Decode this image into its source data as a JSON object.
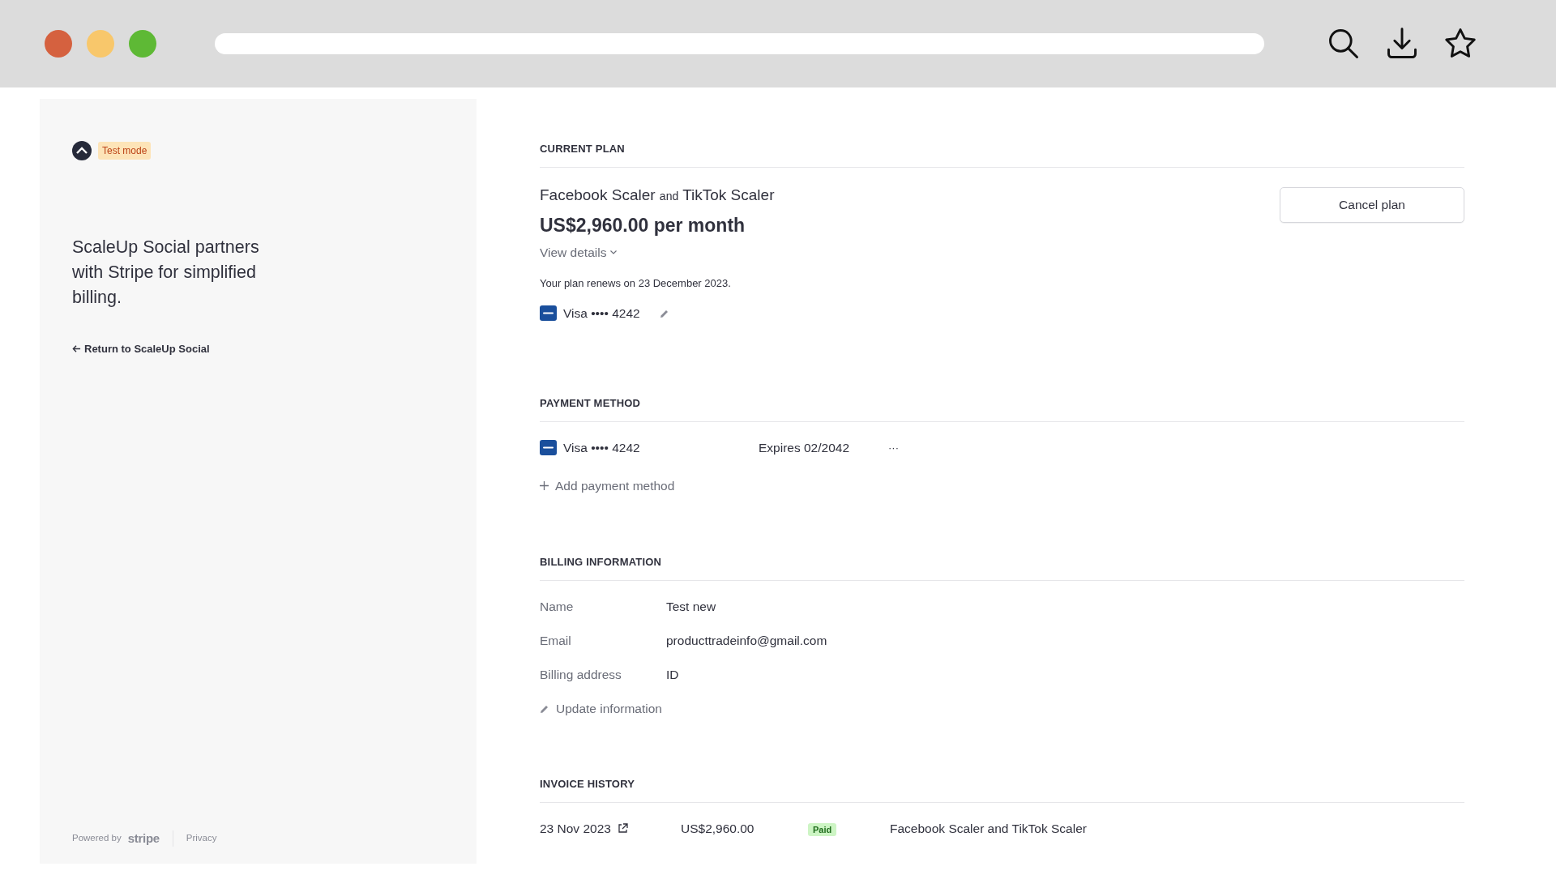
{
  "sidebar": {
    "badge": "Test mode",
    "tagline": "ScaleUp Social partners with Stripe for simplified billing.",
    "return_link": "Return to ScaleUp Social",
    "powered_by": "Powered by",
    "brand": "stripe",
    "privacy": "Privacy"
  },
  "current_plan": {
    "heading": "CURRENT PLAN",
    "products": [
      "Facebook Scaler",
      "TikTok Scaler"
    ],
    "joiner": "and",
    "price": "US$2,960.00 per month",
    "details_toggle": "View details",
    "renewal": "Your plan renews on 23 December 2023.",
    "card": "Visa •••• 4242",
    "cancel_button": "Cancel plan"
  },
  "payment_method": {
    "heading": "PAYMENT METHOD",
    "methods": [
      {
        "card": "Visa •••• 4242",
        "expires": "Expires 02/2042",
        "more": "···"
      }
    ],
    "add_button": "Add payment method"
  },
  "billing_information": {
    "heading": "BILLING INFORMATION",
    "fields": [
      {
        "label": "Name",
        "value": "Test new"
      },
      {
        "label": "Email",
        "value": "producttradeinfo@gmail.com"
      },
      {
        "label": "Billing address",
        "value": "ID"
      }
    ],
    "update_button": "Update information"
  },
  "invoice_history": {
    "heading": "INVOICE HISTORY",
    "rows": [
      {
        "date": "23 Nov 2023",
        "amount": "US$2,960.00",
        "status": "Paid",
        "description": "Facebook Scaler and TikTok Scaler"
      }
    ]
  }
}
